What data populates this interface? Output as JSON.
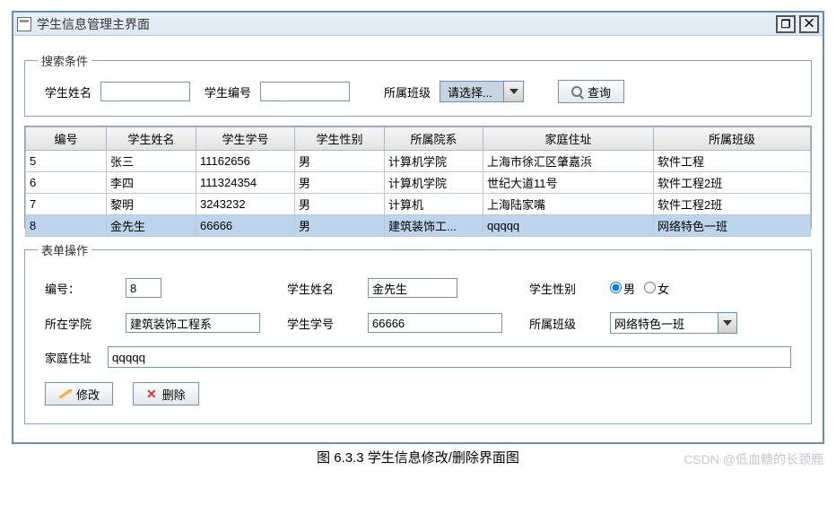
{
  "window": {
    "title": "学生信息管理主界面"
  },
  "search": {
    "legend": "搜索条件",
    "name_label": "学生姓名",
    "id_label": "学生编号",
    "class_label": "所属班级",
    "class_placeholder": "请选择...",
    "query_btn": "查询"
  },
  "table": {
    "headers": [
      "编号",
      "学生姓名",
      "学生学号",
      "学生性别",
      "所属院系",
      "家庭住址",
      "所属班级"
    ],
    "rows": [
      [
        "5",
        "张三",
        "11162656",
        "男",
        "计算机学院",
        "上海市徐汇区肇嘉浜",
        "软件工程"
      ],
      [
        "6",
        "李四",
        "111324354",
        "男",
        "计算机学院",
        "世纪大道11号",
        "软件工程2班"
      ],
      [
        "7",
        "黎明",
        "3243232",
        "男",
        "计算机",
        "上海陆家嘴",
        "软件工程2班"
      ],
      [
        "8",
        "金先生",
        "66666",
        "男",
        "建筑装饰工...",
        "qqqqq",
        "网络特色一班"
      ]
    ],
    "selected_index": 3
  },
  "form": {
    "legend": "表单操作",
    "id_label": "编号：",
    "id_value": "8",
    "name_label": "学生姓名",
    "name_value": "金先生",
    "gender_label": "学生性别",
    "male": "男",
    "female": "女",
    "college_label": "所在学院",
    "college_value": "建筑装饰工程系",
    "sno_label": "学生学号",
    "sno_value": "66666",
    "class_label": "所属班级",
    "class_value": "网络特色一班",
    "address_label": "家庭住址",
    "address_value": "qqqqq",
    "modify_btn": "修改",
    "delete_btn": "删除"
  },
  "caption": "图 6.3.3 学生信息修改/删除界面图",
  "watermark": "CSDN @低血糖的长颈鹿"
}
